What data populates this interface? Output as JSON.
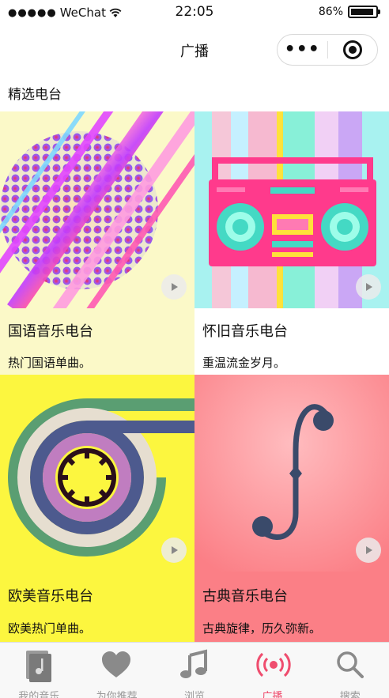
{
  "status_bar": {
    "carrier_dots": "●●●●●",
    "carrier": "WeChat",
    "time": "22:05",
    "battery": "86%"
  },
  "nav": {
    "title": "广播",
    "more_label": "•••"
  },
  "section_title": "精选电台",
  "stations": [
    {
      "title": "国语音乐电台",
      "desc": "热门国语单曲。",
      "bg": "#fbf9c8"
    },
    {
      "title": "怀旧音乐电台",
      "desc": "重温流金岁月。",
      "bg": "#ffffff"
    },
    {
      "title": "欧美音乐电台",
      "desc": "欧美热门单曲。",
      "bg": "#fcf63f"
    },
    {
      "title": "古典音乐电台",
      "desc": "古典旋律，历久弥新。",
      "bg": "#fb7f86"
    }
  ],
  "tabs": [
    {
      "label": "我的音乐",
      "icon": "album-icon",
      "active": false
    },
    {
      "label": "为你推荐",
      "icon": "heart-icon",
      "active": false
    },
    {
      "label": "浏览",
      "icon": "music-note-icon",
      "active": false
    },
    {
      "label": "广播",
      "icon": "broadcast-icon",
      "active": true
    },
    {
      "label": "搜索",
      "icon": "search-icon",
      "active": false
    }
  ],
  "colors": {
    "accent": "#ef4d6e",
    "tab_inactive": "#999999"
  }
}
